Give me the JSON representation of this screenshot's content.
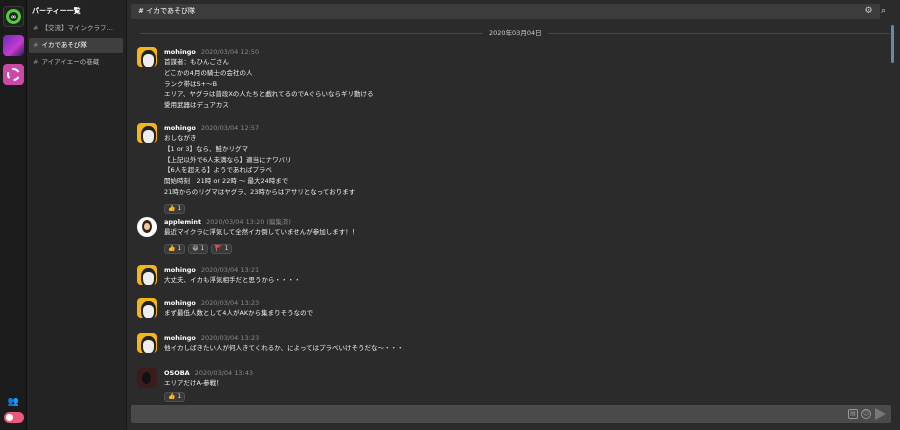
{
  "server_rail": {
    "servers": [
      {
        "name": "server-co",
        "glyph": "∞"
      },
      {
        "name": "server-purple"
      },
      {
        "name": "server-pink"
      }
    ]
  },
  "channels": {
    "title": "パーティー一覧",
    "items": [
      {
        "hash": "#",
        "label": "【交流】マインクラフ…",
        "active": false
      },
      {
        "hash": "#",
        "label": "イカであそび隊",
        "active": true
      },
      {
        "hash": "#",
        "label": "アイアイエーの巻蔵",
        "active": false
      }
    ]
  },
  "header": {
    "title": "# イカであそび隊",
    "settings_icon": "gear-icon",
    "search_icon": "search-icon"
  },
  "date_divider": "2020年03月04日",
  "messages": [
    {
      "user": "mohingo",
      "time": "2020/03/04 12:50",
      "avatar": "mohingo",
      "lines": [
        "首謀者：もひんごさん",
        "どこかの4月の騎士の会社の人",
        "ランク帯はS+〜B",
        "エリア、ヤグラは普段Xの人たちと戯れてるのでAぐらいならギリ動ける",
        "愛用武器はデュアカス"
      ],
      "reactions": []
    },
    {
      "user": "mohingo",
      "time": "2020/03/04 12:57",
      "avatar": "mohingo",
      "lines": [
        "おしながき",
        "【1 or 3】なら、鮭かリグマ",
        "【上記以外で6人未満なら】適当にナワバリ",
        "【6人を超える】ようであればプラベ",
        "開始時刻　21時 or 22時 〜 最大24時まで",
        "21時からのリグマはヤグラ、23時からはアサリとなっております"
      ],
      "reactions": [
        "👍 1"
      ]
    },
    {
      "user": "applemint",
      "time": "2020/03/04 13:20",
      "edited": "(編集済)",
      "avatar": "apple",
      "lines": [
        "最近マイクラに浮気して全然イカ倒していませんが参加します！！"
      ],
      "reactions": [
        "👍 1",
        "😆 1",
        "🚩 1"
      ]
    },
    {
      "user": "mohingo",
      "time": "2020/03/04 13:21",
      "avatar": "mohingo",
      "lines": [
        "大丈夫、イカも浮気相手だと思うから・・・・"
      ],
      "reactions": []
    },
    {
      "user": "mohingo",
      "time": "2020/03/04 13:23",
      "avatar": "mohingo",
      "lines": [
        "まず最低人数として4人がAKから集まりそうなので"
      ],
      "reactions": []
    },
    {
      "user": "mohingo",
      "time": "2020/03/04 13:23",
      "avatar": "mohingo",
      "lines": [
        "他イカしばきたい人が何人きてくれるか、によってはプラベいけそうだな〜・・・"
      ],
      "reactions": []
    },
    {
      "user": "OSOBA",
      "time": "2020/03/04 13:43",
      "avatar": "osoba",
      "lines": [
        "エリアだけA-参戦！"
      ],
      "reactions": [
        "👍 1"
      ]
    }
  ],
  "composer": {
    "attach_icon": "attach-icon",
    "emoji_icon": "emoji-icon",
    "send_icon": "send-icon"
  }
}
